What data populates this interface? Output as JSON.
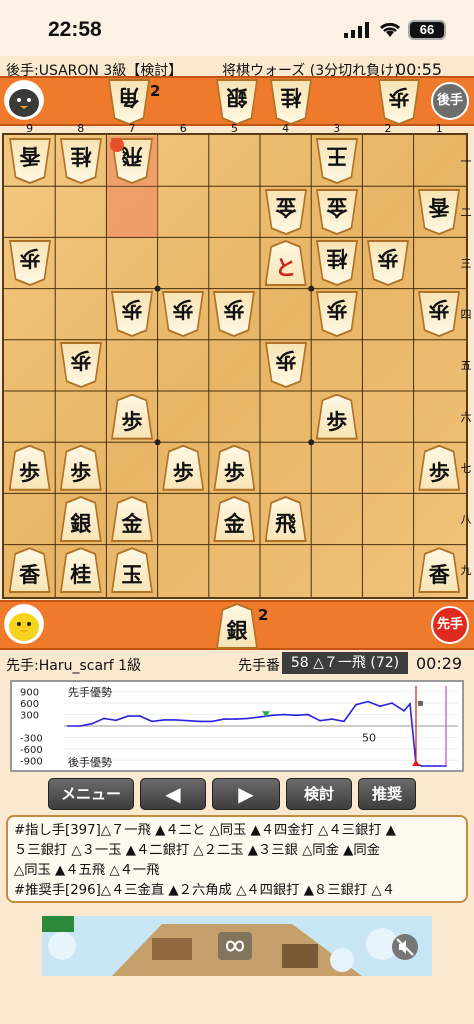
{
  "status_bar": {
    "time": "22:58",
    "battery": "66"
  },
  "game_info": {
    "gote_player": "後手:USARON 3級【検討】",
    "game_type": "将棋ウォーズ (3分切れ負け)",
    "gote_time": "00:55",
    "sente_player": "先手:Haru_scarf 1級",
    "turn_label": "先手番",
    "current_move": "58 △７一飛 (72)",
    "sente_time": "00:29"
  },
  "badges": {
    "gote": "後手",
    "sente": "先手"
  },
  "gote_hand": [
    {
      "piece": "角",
      "count": "2"
    },
    {
      "piece": "銀",
      "count": ""
    },
    {
      "piece": "桂",
      "count": ""
    },
    {
      "piece": "歩",
      "count": ""
    }
  ],
  "sente_hand": [
    {
      "piece": "銀",
      "count": "2"
    }
  ],
  "file_labels": [
    "9",
    "8",
    "7",
    "6",
    "5",
    "4",
    "3",
    "2",
    "1"
  ],
  "rank_labels": [
    "一",
    "二",
    "三",
    "四",
    "五",
    "六",
    "七",
    "八",
    "九"
  ],
  "board": [
    {
      "file": 9,
      "rank": 1,
      "piece": "香",
      "side": "gote"
    },
    {
      "file": 8,
      "rank": 1,
      "piece": "桂",
      "side": "gote"
    },
    {
      "file": 7,
      "rank": 1,
      "piece": "飛",
      "side": "gote"
    },
    {
      "file": 3,
      "rank": 1,
      "piece": "王",
      "side": "gote"
    },
    {
      "file": 4,
      "rank": 2,
      "piece": "金",
      "side": "gote"
    },
    {
      "file": 3,
      "rank": 2,
      "piece": "金",
      "side": "gote"
    },
    {
      "file": 1,
      "rank": 2,
      "piece": "香",
      "side": "gote"
    },
    {
      "file": 9,
      "rank": 3,
      "piece": "歩",
      "side": "gote"
    },
    {
      "file": 4,
      "rank": 3,
      "piece": "と",
      "side": "sente",
      "promoted": true
    },
    {
      "file": 3,
      "rank": 3,
      "piece": "桂",
      "side": "gote"
    },
    {
      "file": 2,
      "rank": 3,
      "piece": "歩",
      "side": "gote"
    },
    {
      "file": 7,
      "rank": 4,
      "piece": "歩",
      "side": "gote"
    },
    {
      "file": 6,
      "rank": 4,
      "piece": "歩",
      "side": "gote"
    },
    {
      "file": 5,
      "rank": 4,
      "piece": "歩",
      "side": "gote"
    },
    {
      "file": 3,
      "rank": 4,
      "piece": "歩",
      "side": "gote"
    },
    {
      "file": 1,
      "rank": 4,
      "piece": "歩",
      "side": "gote"
    },
    {
      "file": 8,
      "rank": 5,
      "piece": "歩",
      "side": "gote"
    },
    {
      "file": 4,
      "rank": 5,
      "piece": "歩",
      "side": "gote"
    },
    {
      "file": 7,
      "rank": 6,
      "piece": "歩",
      "side": "sente"
    },
    {
      "file": 3,
      "rank": 6,
      "piece": "歩",
      "side": "sente"
    },
    {
      "file": 9,
      "rank": 7,
      "piece": "歩",
      "side": "sente"
    },
    {
      "file": 8,
      "rank": 7,
      "piece": "歩",
      "side": "sente"
    },
    {
      "file": 6,
      "rank": 7,
      "piece": "歩",
      "side": "sente"
    },
    {
      "file": 5,
      "rank": 7,
      "piece": "歩",
      "side": "sente"
    },
    {
      "file": 1,
      "rank": 7,
      "piece": "歩",
      "side": "sente"
    },
    {
      "file": 8,
      "rank": 8,
      "piece": "銀",
      "side": "sente"
    },
    {
      "file": 7,
      "rank": 8,
      "piece": "金",
      "side": "sente"
    },
    {
      "file": 5,
      "rank": 8,
      "piece": "金",
      "side": "sente"
    },
    {
      "file": 4,
      "rank": 8,
      "piece": "飛",
      "side": "sente"
    },
    {
      "file": 9,
      "rank": 9,
      "piece": "香",
      "side": "sente"
    },
    {
      "file": 8,
      "rank": 9,
      "piece": "桂",
      "side": "sente"
    },
    {
      "file": 7,
      "rank": 9,
      "piece": "玉",
      "side": "sente"
    },
    {
      "file": 1,
      "rank": 9,
      "piece": "香",
      "side": "sente"
    }
  ],
  "last_move": {
    "from": {
      "file": 7,
      "rank": 2
    },
    "to": {
      "file": 7,
      "rank": 1
    }
  },
  "eval_graph": {
    "y_labels": [
      "900",
      "600",
      "300",
      "-300",
      "-600",
      "-900"
    ],
    "top_label": "先手優勢",
    "bottom_label": "後手優勢",
    "x_label": "50",
    "moves": [
      0,
      2,
      4,
      6,
      8,
      10,
      12,
      14,
      16,
      18,
      20,
      22,
      24,
      26,
      28,
      30,
      32,
      34,
      36,
      38,
      40,
      42,
      44,
      46,
      48,
      50,
      52,
      54,
      56,
      57,
      58,
      59,
      60,
      61,
      62,
      63
    ],
    "values": [
      0,
      0,
      60,
      200,
      150,
      260,
      260,
      120,
      160,
      160,
      140,
      120,
      120,
      180,
      180,
      200,
      240,
      280,
      300,
      280,
      300,
      140,
      180,
      120,
      560,
      640,
      520,
      600,
      400,
      580,
      -1000,
      -1100,
      -1150,
      -1200,
      -1200,
      -1200
    ],
    "current_move": 58,
    "colors": {
      "line": "#2a22e0",
      "marker": "#e01616",
      "cursor": "#c84ad2",
      "green": "#22b04a"
    }
  },
  "buttons": {
    "menu": "メニュー",
    "prev": "◀",
    "next": "▶",
    "review": "検討",
    "recommend": "推奨"
  },
  "kifu": {
    "line1": "#指し手[397]△７一飛 ▲４二と △同玉 ▲４四金打 △４三銀打 ▲",
    "line2": "５三銀打 △３一玉 ▲４二銀打 △２二玉 ▲３三銀 △同金 ▲同金",
    "line3": "△同玉 ▲４五飛 △４一飛",
    "line4": "#推奨手[296]△４三金直 ▲２六角成 △４四銀打 ▲８三銀打 △４"
  }
}
